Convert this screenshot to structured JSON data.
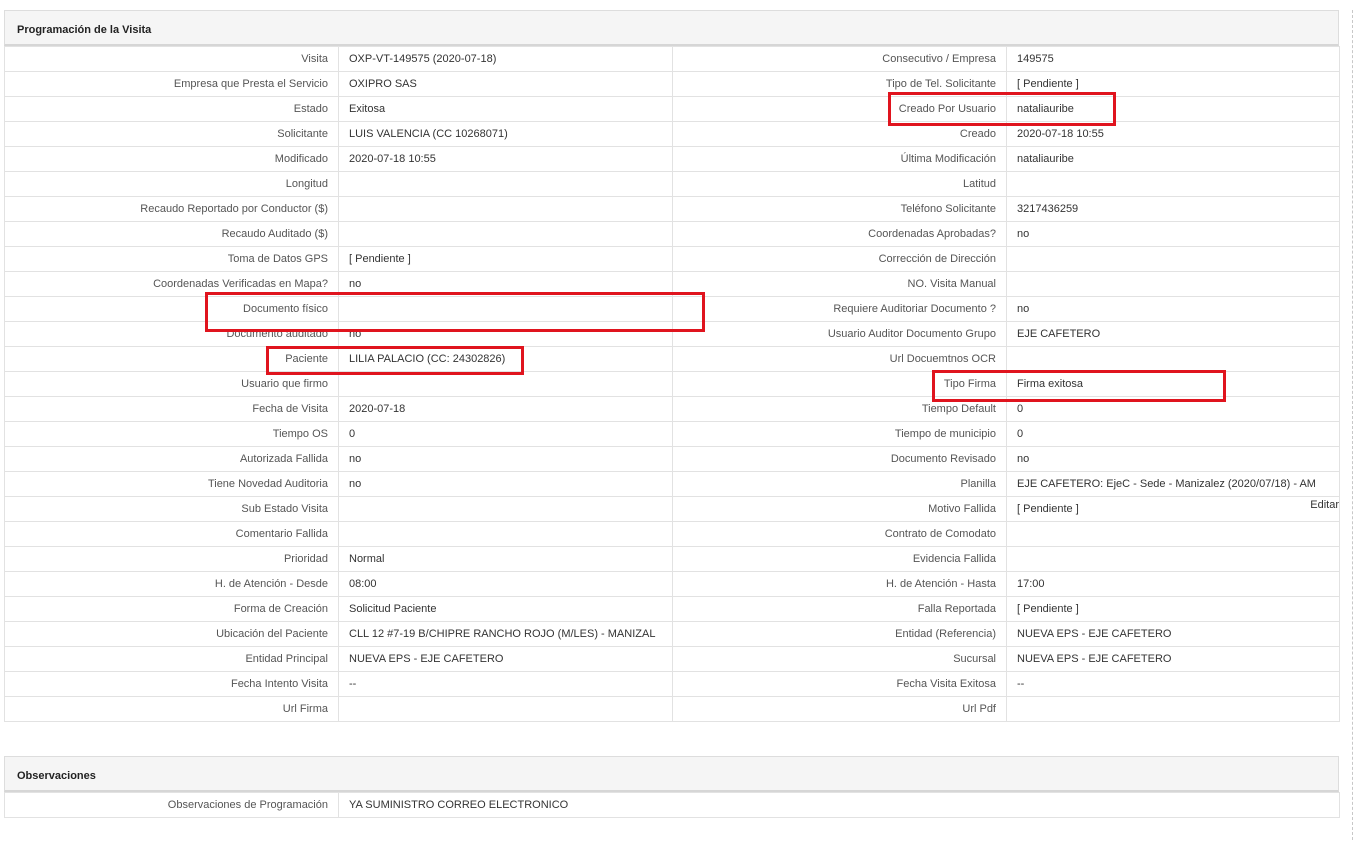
{
  "programacion": {
    "title": "Programación de la Visita",
    "rows": [
      {
        "l1": "Visita",
        "v1": "OXP-VT-149575 (2020-07-18)",
        "l2": "Consecutivo / Empresa",
        "v2": "149575"
      },
      {
        "l1": "Empresa que Presta el Servicio",
        "v1": "OXIPRO SAS",
        "l2": "Tipo de Tel. Solicitante",
        "v2": "[ Pendiente ]"
      },
      {
        "l1": "Estado",
        "v1": "Exitosa",
        "l2": "Creado Por Usuario",
        "v2": "nataliauribe"
      },
      {
        "l1": "Solicitante",
        "v1": "LUIS VALENCIA (CC 10268071)",
        "l2": "Creado",
        "v2": "2020-07-18 10:55"
      },
      {
        "l1": "Modificado",
        "v1": "2020-07-18 10:55",
        "l2": "Última Modificación",
        "v2": " nataliauribe"
      },
      {
        "l1": "Longitud",
        "v1": "",
        "l2": "Latitud",
        "v2": ""
      },
      {
        "l1": "Recaudo Reportado por Conductor ($)",
        "v1": "",
        "l2": "Teléfono Solicitante",
        "v2": "3217436259"
      },
      {
        "l1": "Recaudo Auditado ($)",
        "v1": "",
        "l2": "Coordenadas Aprobadas?",
        "v2": " no"
      },
      {
        "l1": "Toma de Datos GPS",
        "v1": "[ Pendiente ]",
        "l2": "Corrección de Dirección",
        "v2": ""
      },
      {
        "l1": "Coordenadas Verificadas en Mapa?",
        "v1": " no",
        "l2": "NO. Visita Manual",
        "v2": ""
      },
      {
        "l1": "Documento físico",
        "v1": "",
        "l2": "Requiere Auditoriar Documento ?",
        "v2": " no"
      },
      {
        "l1": "Documento auditado",
        "v1": " no",
        "l2": "Usuario Auditor Documento Grupo",
        "v2": "EJE CAFETERO"
      },
      {
        "l1": "Paciente",
        "v1": "LILIA PALACIO (CC: 24302826)",
        "l2": "Url Docuemtnos OCR",
        "v2": ""
      },
      {
        "l1": "Usuario que firmo",
        "v1": "",
        "l2": "Tipo Firma",
        "v2": "Firma exitosa"
      },
      {
        "l1": "Fecha de Visita",
        "v1": " 2020-07-18",
        "l2": "Tiempo Default",
        "v2": "0"
      },
      {
        "l1": "Tiempo OS",
        "v1": "0",
        "l2": "Tiempo de municipio",
        "v2": "0"
      },
      {
        "l1": "Autorizada Fallida",
        "v1": " no",
        "l2": "Documento Revisado",
        "v2": " no"
      },
      {
        "l1": "Tiene Novedad Auditoria",
        "v1": " no",
        "l2": "Planilla",
        "v2": "EJE CAFETERO: EjeC - Sede - Manizalez (2020/07/18) - AM"
      },
      {
        "l1": "Sub Estado Visita",
        "v1": "",
        "l2": "Motivo Fallida",
        "v2": "[ Pendiente ]"
      },
      {
        "l1": "Comentario Fallida",
        "v1": "",
        "l2": "Contrato de Comodato",
        "v2": ""
      },
      {
        "l1": "Prioridad",
        "v1": "Normal",
        "l2": "Evidencia Fallida",
        "v2": ""
      },
      {
        "l1": "H. de Atención - Desde",
        "v1": "08:00",
        "l2": "H. de Atención - Hasta",
        "v2": "17:00"
      },
      {
        "l1": "Forma de Creación",
        "v1": "Solicitud Paciente",
        "l2": "Falla Reportada",
        "v2": "[ Pendiente ]"
      },
      {
        "l1": "Ubicación del Paciente",
        "v1": "CLL 12 #7-19 B/CHIPRE RANCHO ROJO (M/LES) - MANIZAL",
        "l2": "Entidad (Referencia)",
        "v2": "NUEVA EPS - EJE CAFETERO"
      },
      {
        "l1": "Entidad Principal",
        "v1": "NUEVA EPS - EJE CAFETERO",
        "l2": "Sucursal",
        "v2": "NUEVA EPS - EJE CAFETERO"
      },
      {
        "l1": "Fecha Intento Visita",
        "v1": " --",
        "l2": "Fecha Visita Exitosa",
        "v2": " --"
      },
      {
        "l1": "Url Firma",
        "v1": "",
        "l2": "Url Pdf",
        "v2": ""
      }
    ],
    "editar": "Editar"
  },
  "observaciones": {
    "title": "Observaciones",
    "label": "Observaciones de Programación",
    "value": " YA SUMINISTRO CORREO ELECTRONICO"
  },
  "colors": {
    "highlight": "#e0141e",
    "header_bg": "#f5f5f5",
    "border": "#dddddd"
  }
}
